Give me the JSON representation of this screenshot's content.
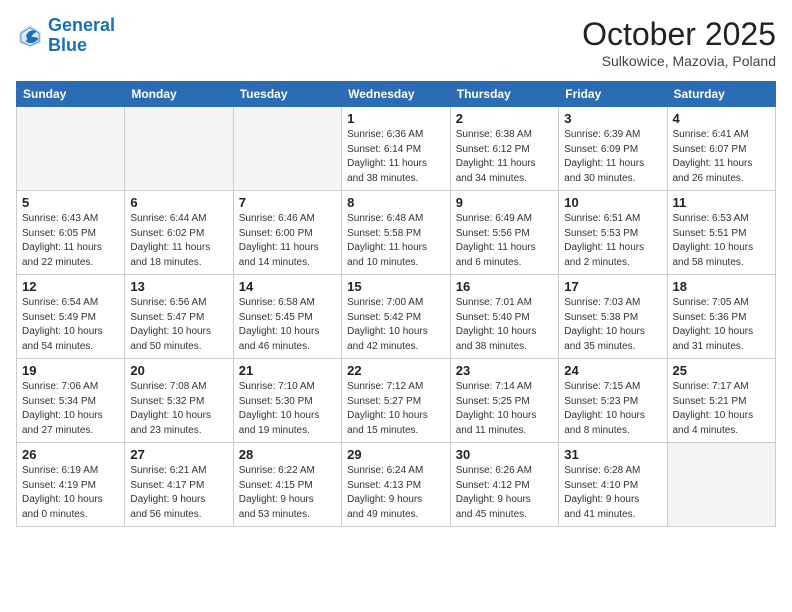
{
  "logo": {
    "line1": "General",
    "line2": "Blue"
  },
  "title": "October 2025",
  "subtitle": "Sulkowice, Mazovia, Poland",
  "weekdays": [
    "Sunday",
    "Monday",
    "Tuesday",
    "Wednesday",
    "Thursday",
    "Friday",
    "Saturday"
  ],
  "weeks": [
    [
      {
        "day": "",
        "info": ""
      },
      {
        "day": "",
        "info": ""
      },
      {
        "day": "",
        "info": ""
      },
      {
        "day": "1",
        "info": "Sunrise: 6:36 AM\nSunset: 6:14 PM\nDaylight: 11 hours\nand 38 minutes."
      },
      {
        "day": "2",
        "info": "Sunrise: 6:38 AM\nSunset: 6:12 PM\nDaylight: 11 hours\nand 34 minutes."
      },
      {
        "day": "3",
        "info": "Sunrise: 6:39 AM\nSunset: 6:09 PM\nDaylight: 11 hours\nand 30 minutes."
      },
      {
        "day": "4",
        "info": "Sunrise: 6:41 AM\nSunset: 6:07 PM\nDaylight: 11 hours\nand 26 minutes."
      }
    ],
    [
      {
        "day": "5",
        "info": "Sunrise: 6:43 AM\nSunset: 6:05 PM\nDaylight: 11 hours\nand 22 minutes."
      },
      {
        "day": "6",
        "info": "Sunrise: 6:44 AM\nSunset: 6:02 PM\nDaylight: 11 hours\nand 18 minutes."
      },
      {
        "day": "7",
        "info": "Sunrise: 6:46 AM\nSunset: 6:00 PM\nDaylight: 11 hours\nand 14 minutes."
      },
      {
        "day": "8",
        "info": "Sunrise: 6:48 AM\nSunset: 5:58 PM\nDaylight: 11 hours\nand 10 minutes."
      },
      {
        "day": "9",
        "info": "Sunrise: 6:49 AM\nSunset: 5:56 PM\nDaylight: 11 hours\nand 6 minutes."
      },
      {
        "day": "10",
        "info": "Sunrise: 6:51 AM\nSunset: 5:53 PM\nDaylight: 11 hours\nand 2 minutes."
      },
      {
        "day": "11",
        "info": "Sunrise: 6:53 AM\nSunset: 5:51 PM\nDaylight: 10 hours\nand 58 minutes."
      }
    ],
    [
      {
        "day": "12",
        "info": "Sunrise: 6:54 AM\nSunset: 5:49 PM\nDaylight: 10 hours\nand 54 minutes."
      },
      {
        "day": "13",
        "info": "Sunrise: 6:56 AM\nSunset: 5:47 PM\nDaylight: 10 hours\nand 50 minutes."
      },
      {
        "day": "14",
        "info": "Sunrise: 6:58 AM\nSunset: 5:45 PM\nDaylight: 10 hours\nand 46 minutes."
      },
      {
        "day": "15",
        "info": "Sunrise: 7:00 AM\nSunset: 5:42 PM\nDaylight: 10 hours\nand 42 minutes."
      },
      {
        "day": "16",
        "info": "Sunrise: 7:01 AM\nSunset: 5:40 PM\nDaylight: 10 hours\nand 38 minutes."
      },
      {
        "day": "17",
        "info": "Sunrise: 7:03 AM\nSunset: 5:38 PM\nDaylight: 10 hours\nand 35 minutes."
      },
      {
        "day": "18",
        "info": "Sunrise: 7:05 AM\nSunset: 5:36 PM\nDaylight: 10 hours\nand 31 minutes."
      }
    ],
    [
      {
        "day": "19",
        "info": "Sunrise: 7:06 AM\nSunset: 5:34 PM\nDaylight: 10 hours\nand 27 minutes."
      },
      {
        "day": "20",
        "info": "Sunrise: 7:08 AM\nSunset: 5:32 PM\nDaylight: 10 hours\nand 23 minutes."
      },
      {
        "day": "21",
        "info": "Sunrise: 7:10 AM\nSunset: 5:30 PM\nDaylight: 10 hours\nand 19 minutes."
      },
      {
        "day": "22",
        "info": "Sunrise: 7:12 AM\nSunset: 5:27 PM\nDaylight: 10 hours\nand 15 minutes."
      },
      {
        "day": "23",
        "info": "Sunrise: 7:14 AM\nSunset: 5:25 PM\nDaylight: 10 hours\nand 11 minutes."
      },
      {
        "day": "24",
        "info": "Sunrise: 7:15 AM\nSunset: 5:23 PM\nDaylight: 10 hours\nand 8 minutes."
      },
      {
        "day": "25",
        "info": "Sunrise: 7:17 AM\nSunset: 5:21 PM\nDaylight: 10 hours\nand 4 minutes."
      }
    ],
    [
      {
        "day": "26",
        "info": "Sunrise: 6:19 AM\nSunset: 4:19 PM\nDaylight: 10 hours\nand 0 minutes."
      },
      {
        "day": "27",
        "info": "Sunrise: 6:21 AM\nSunset: 4:17 PM\nDaylight: 9 hours\nand 56 minutes."
      },
      {
        "day": "28",
        "info": "Sunrise: 6:22 AM\nSunset: 4:15 PM\nDaylight: 9 hours\nand 53 minutes."
      },
      {
        "day": "29",
        "info": "Sunrise: 6:24 AM\nSunset: 4:13 PM\nDaylight: 9 hours\nand 49 minutes."
      },
      {
        "day": "30",
        "info": "Sunrise: 6:26 AM\nSunset: 4:12 PM\nDaylight: 9 hours\nand 45 minutes."
      },
      {
        "day": "31",
        "info": "Sunrise: 6:28 AM\nSunset: 4:10 PM\nDaylight: 9 hours\nand 41 minutes."
      },
      {
        "day": "",
        "info": ""
      }
    ]
  ]
}
